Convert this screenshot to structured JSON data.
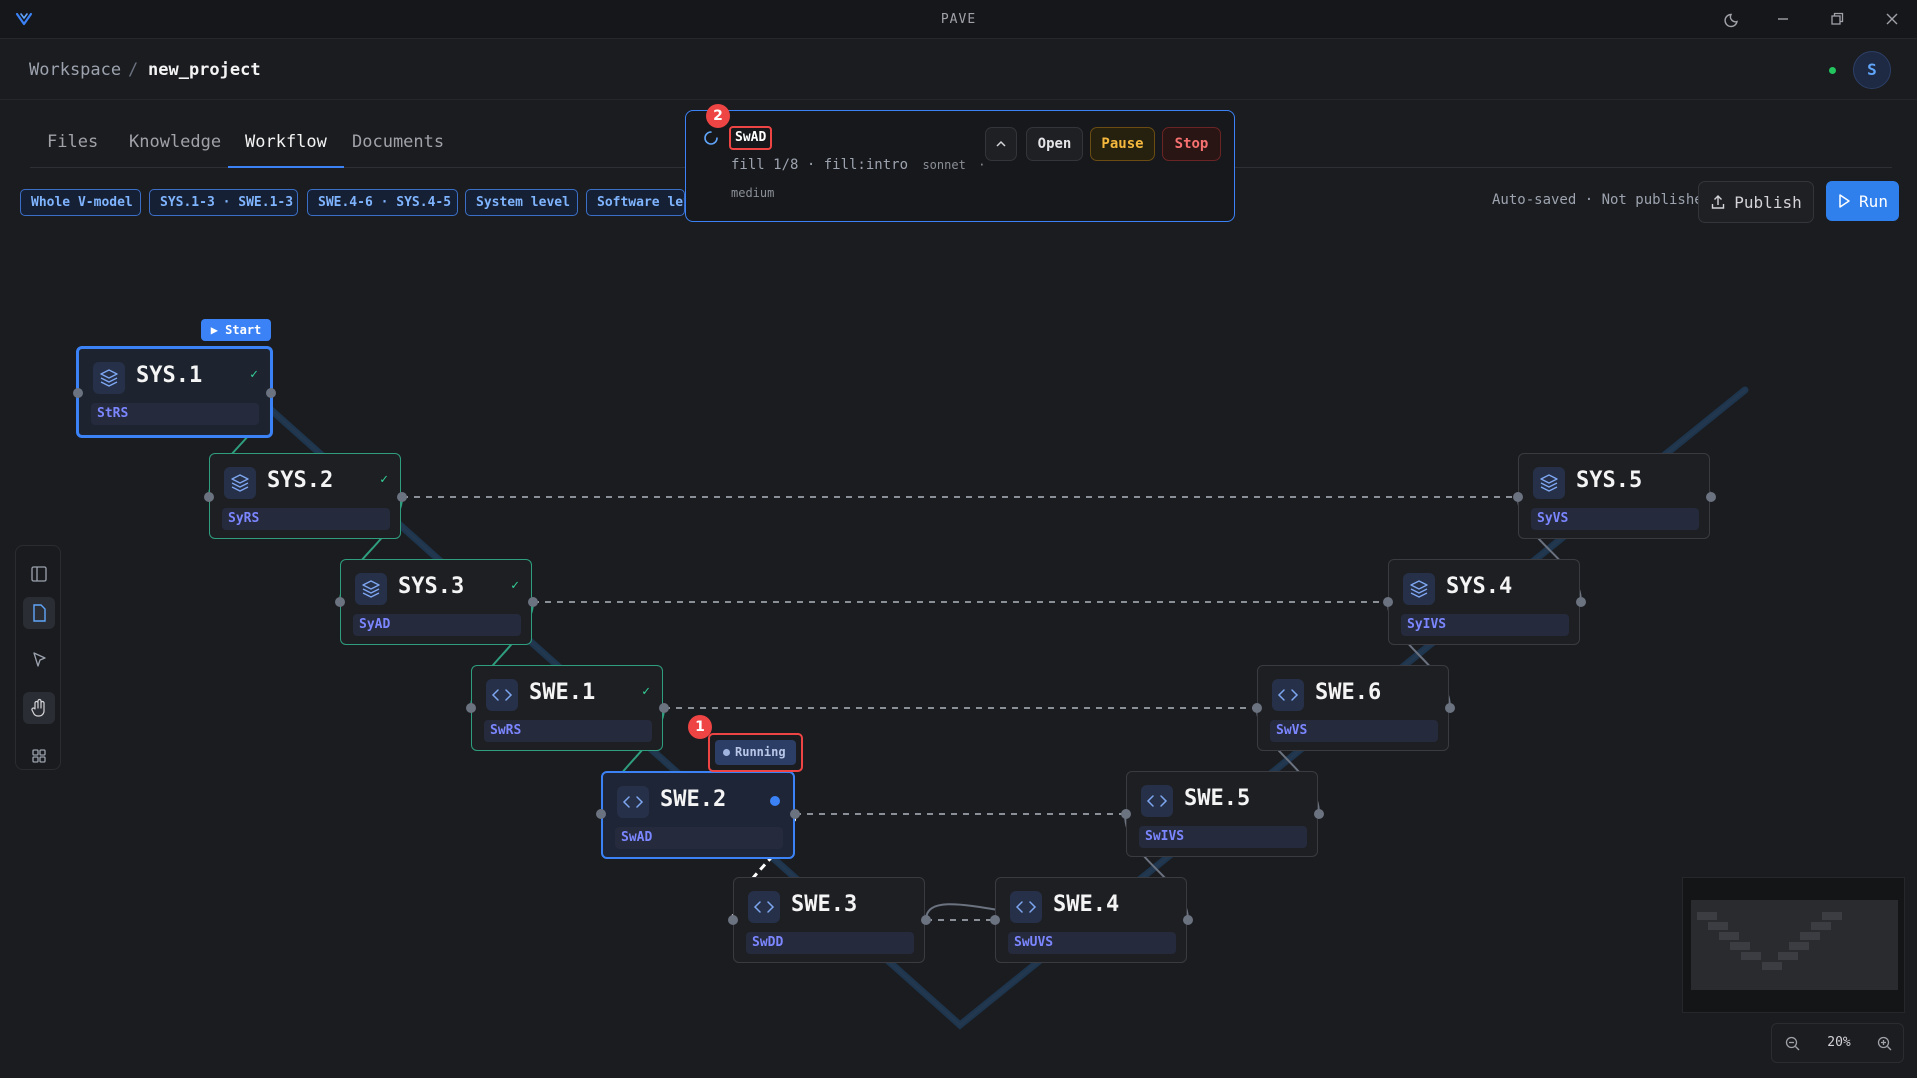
{
  "app": {
    "title": "PAVE"
  },
  "breadcrumb": {
    "workspace": "Workspace",
    "separator": "/",
    "project": "new_project"
  },
  "user": {
    "avatar_initial": "S",
    "online": true
  },
  "tabs": [
    {
      "label": "Files",
      "active": false
    },
    {
      "label": "Knowledge",
      "active": false
    },
    {
      "label": "Workflow",
      "active": true
    },
    {
      "label": "Documents",
      "active": false
    }
  ],
  "filters": [
    "Whole V-model",
    "SYS.1-3 · SWE.1-3",
    "SWE.4-6 · SYS.4-5",
    "System level",
    "Software level"
  ],
  "status": {
    "autosave": "Auto-saved · Not published"
  },
  "actions": {
    "publish": "Publish",
    "run": "Run"
  },
  "popup": {
    "title": "SwAD",
    "line1": "fill 1/8 · fill:intro",
    "model": "sonnet",
    "line1_tail": "·",
    "line2": "medium",
    "open": "Open",
    "pause": "Pause",
    "stop": "Stop"
  },
  "markers": {
    "running": "1",
    "popup": "2"
  },
  "start_label": "Start",
  "running_label": "Running",
  "nodes": {
    "sys1": {
      "title": "SYS.1",
      "sub": "StRS",
      "status": "done",
      "kind": "system"
    },
    "sys2": {
      "title": "SYS.2",
      "sub": "SyRS",
      "status": "done",
      "kind": "system"
    },
    "sys3": {
      "title": "SYS.3",
      "sub": "SyAD",
      "status": "done",
      "kind": "system"
    },
    "swe1": {
      "title": "SWE.1",
      "sub": "SwRS",
      "status": "done",
      "kind": "software"
    },
    "swe2": {
      "title": "SWE.2",
      "sub": "SwAD",
      "status": "running",
      "kind": "software"
    },
    "swe3": {
      "title": "SWE.3",
      "sub": "SwDD",
      "status": "idle",
      "kind": "software"
    },
    "swe4": {
      "title": "SWE.4",
      "sub": "SwUVS",
      "status": "idle",
      "kind": "software"
    },
    "swe5": {
      "title": "SWE.5",
      "sub": "SwIVS",
      "status": "idle",
      "kind": "software"
    },
    "swe6": {
      "title": "SWE.6",
      "sub": "SwVS",
      "status": "idle",
      "kind": "software"
    },
    "sys4": {
      "title": "SYS.4",
      "sub": "SyIVS",
      "status": "idle",
      "kind": "system"
    },
    "sys5": {
      "title": "SYS.5",
      "sub": "SyVS",
      "status": "idle",
      "kind": "system"
    }
  },
  "check_mark": "✓",
  "zoom": {
    "value": "20%"
  },
  "colors": {
    "accent": "#3b82f6",
    "done": "#2f9e7f",
    "danger": "#ef4444",
    "warning": "#f5b83d"
  }
}
